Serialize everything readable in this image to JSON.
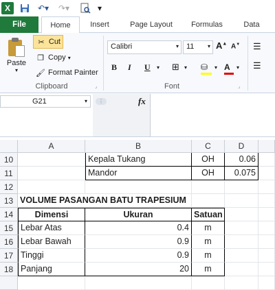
{
  "qat": {
    "app_icon": "excel-logo-icon",
    "app_letter": "X",
    "icons": [
      "save-icon",
      "undo-icon",
      "redo-icon",
      "print-preview-icon",
      "customize-dropdown-icon"
    ]
  },
  "tabs": {
    "file": "File",
    "home": "Home",
    "insert": "Insert",
    "page_layout": "Page Layout",
    "formulas": "Formulas",
    "data": "Data"
  },
  "clipboard": {
    "paste": "Paste",
    "cut": "Cut",
    "copy": "Copy",
    "format_painter": "Format Painter",
    "group_label": "Clipboard"
  },
  "font": {
    "name": "Calibri",
    "size": "11",
    "bold": "B",
    "italic": "I",
    "underline": "U",
    "color_letter": "A",
    "fill_color": "#ffff00",
    "font_color": "#e00000",
    "group_label": "Font"
  },
  "formula_bar": {
    "name_box": "G21",
    "fx": "fx",
    "formula": ""
  },
  "grid": {
    "columns": [
      "A",
      "B",
      "C",
      "D"
    ],
    "rows": [
      {
        "num": "10",
        "A": "",
        "B": "Kepala Tukang",
        "C": "OH",
        "D": "0.06"
      },
      {
        "num": "11",
        "A": "",
        "B": "Mandor",
        "C": "OH",
        "D": "0.075"
      },
      {
        "num": "12",
        "A": "",
        "B": "",
        "C": "",
        "D": ""
      },
      {
        "num": "13",
        "A": "VOLUME PASANGAN BATU TRAPESIUM",
        "B": "",
        "C": "",
        "D": ""
      },
      {
        "num": "14",
        "A": "Dimensi",
        "B": "Ukuran",
        "C": "Satuan",
        "D": ""
      },
      {
        "num": "15",
        "A": "Lebar Atas",
        "B": "0.4",
        "C": "m",
        "D": ""
      },
      {
        "num": "16",
        "A": "Lebar Bawah",
        "B": "0.9",
        "C": "m",
        "D": ""
      },
      {
        "num": "17",
        "A": "Tinggi",
        "B": "0.9",
        "C": "m",
        "D": ""
      },
      {
        "num": "18",
        "A": "Panjang",
        "B": "20",
        "C": "m",
        "D": ""
      }
    ]
  }
}
